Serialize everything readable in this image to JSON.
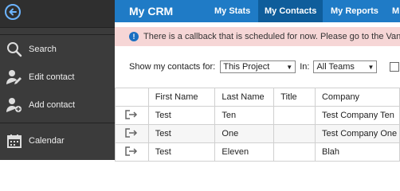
{
  "sidebar": {
    "items": [
      {
        "label": "Search",
        "icon": "search-icon"
      },
      {
        "label": "Edit contact",
        "icon": "edit-contact-icon"
      },
      {
        "label": "Add contact",
        "icon": "add-contact-icon"
      },
      {
        "label": "Calendar",
        "icon": "calendar-icon"
      }
    ]
  },
  "header": {
    "brand": "My CRM",
    "nav": [
      {
        "label": "My Stats"
      },
      {
        "label": "My Contacts",
        "active": true
      },
      {
        "label": "My Reports"
      },
      {
        "label": "M"
      }
    ]
  },
  "alert": {
    "text": "There is a callback that is scheduled for now. Please go to the VanillaSo"
  },
  "filters": {
    "show_label": "Show my contacts for:",
    "project_value": "This Project",
    "in_label": "In:",
    "teams_value": "All Teams"
  },
  "table": {
    "columns": [
      "",
      "First Name",
      "Last Name",
      "Title",
      "Company"
    ],
    "rows": [
      [
        "Test",
        "Ten",
        "",
        "Test Company Ten"
      ],
      [
        "Test",
        "One",
        "",
        "Test Company One"
      ],
      [
        "Test",
        "Eleven",
        "",
        "Blah"
      ]
    ]
  },
  "colors": {
    "nav_bg": "#1f7bc6",
    "nav_active": "#0f5d9b",
    "sidebar_bg": "#3b3b3b",
    "alert_bg": "#f6d6d6"
  }
}
